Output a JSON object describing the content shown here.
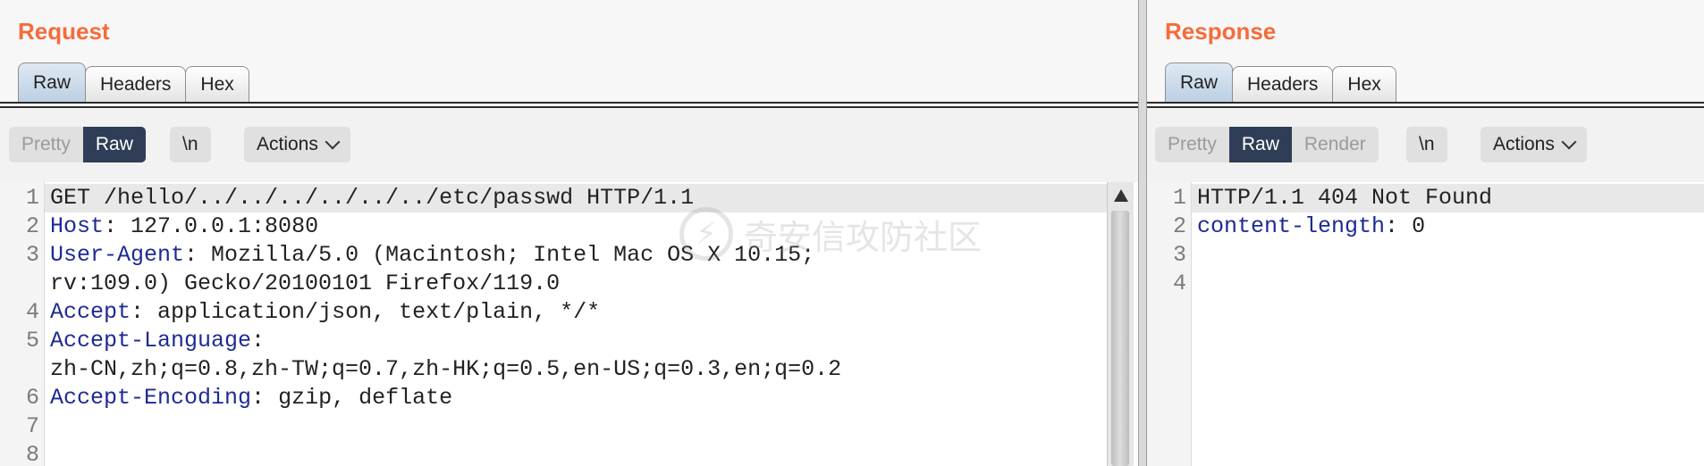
{
  "request": {
    "title": "Request",
    "tabs": [
      "Raw",
      "Headers",
      "Hex"
    ],
    "active_tab": "Raw",
    "view_modes": [
      "Pretty",
      "Raw"
    ],
    "active_view": "Raw",
    "newline_label": "\\n",
    "actions_label": "Actions",
    "lines": [
      {
        "num": "1",
        "key": "",
        "sep": "",
        "val": "GET /hello/../../../../../../etc/passwd HTTP/1.1"
      },
      {
        "num": "2",
        "key": "Host",
        "sep": ":",
        "val": " 127.0.0.1:8080"
      },
      {
        "num": "3",
        "key": "User-Agent",
        "sep": ":",
        "val": " Mozilla/5.0 (Macintosh; Intel Mac OS X 10.15;"
      },
      {
        "num": "",
        "key": "",
        "sep": "",
        "val": "rv:109.0) Gecko/20100101 Firefox/119.0"
      },
      {
        "num": "4",
        "key": "Accept",
        "sep": ":",
        "val": " application/json, text/plain, */*"
      },
      {
        "num": "5",
        "key": "Accept-Language",
        "sep": ":",
        "val": ""
      },
      {
        "num": "",
        "key": "",
        "sep": "",
        "val": "zh-CN,zh;q=0.8,zh-TW;q=0.7,zh-HK;q=0.5,en-US;q=0.3,en;q=0.2"
      },
      {
        "num": "6",
        "key": "Accept-Encoding",
        "sep": ":",
        "val": " gzip, deflate"
      },
      {
        "num": "7",
        "key": "",
        "sep": "",
        "val": ""
      },
      {
        "num": "8",
        "key": "",
        "sep": "",
        "val": ""
      }
    ]
  },
  "response": {
    "title": "Response",
    "tabs": [
      "Raw",
      "Headers",
      "Hex"
    ],
    "active_tab": "Raw",
    "view_modes": [
      "Pretty",
      "Raw",
      "Render"
    ],
    "active_view": "Raw",
    "newline_label": "\\n",
    "actions_label": "Actions",
    "lines": [
      {
        "num": "1",
        "key": "",
        "sep": "",
        "val": "HTTP/1.1 404 Not Found"
      },
      {
        "num": "2",
        "key": "content-length",
        "sep": ":",
        "val": " 0"
      },
      {
        "num": "3",
        "key": "",
        "sep": "",
        "val": ""
      },
      {
        "num": "4",
        "key": "",
        "sep": "",
        "val": ""
      }
    ]
  },
  "watermark": {
    "icon": "lightning-shield-icon",
    "text": "奇安信攻防社区"
  },
  "colors": {
    "title": "#f56c3b",
    "header_key": "#1e2a94",
    "active_view_bg": "#2f3d57"
  }
}
